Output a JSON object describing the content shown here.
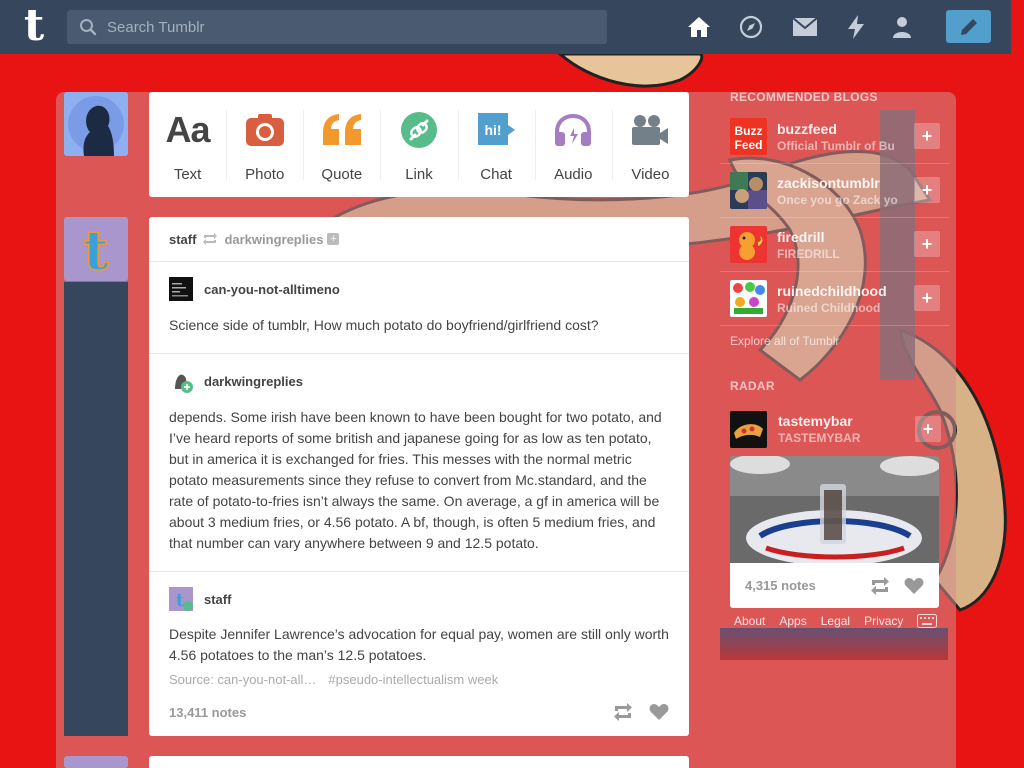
{
  "header": {
    "logo": "t",
    "search_placeholder": "Search Tumblr",
    "nav_icons": [
      "home-icon",
      "explore-icon",
      "inbox-icon",
      "activity-icon",
      "account-icon"
    ],
    "compose_icon": "pencil-icon"
  },
  "post_types": [
    {
      "label": "Text",
      "icon": "text-icon",
      "color": "#444444"
    },
    {
      "label": "Photo",
      "icon": "camera-icon",
      "color": "#d95e40"
    },
    {
      "label": "Quote",
      "icon": "quote-icon",
      "color": "#f2992e"
    },
    {
      "label": "Link",
      "icon": "link-icon",
      "color": "#56bc8a"
    },
    {
      "label": "Chat",
      "icon": "chat-icon",
      "color": "#529ecc"
    },
    {
      "label": "Audio",
      "icon": "headphones-icon",
      "color": "#a77dc2"
    },
    {
      "label": "Video",
      "icon": "video-icon",
      "color": "#748089"
    }
  ],
  "post": {
    "author": "staff",
    "reblogged_from": "darkwingreplies",
    "reblogs": [
      {
        "user": "can-you-not-alltimeno",
        "text": "Science side of tumblr, How much potato do boyfriend/girlfriend cost?"
      },
      {
        "user": "darkwingreplies",
        "text": "depends. Some irish have been known to have been bought for two potato, and I’ve heard reports of some british and japanese going for as low as ten potato, but in america it is exchanged for fries. This messes with the normal metric potato measurements since they refuse to convert from Mc.standard, and the rate of potato-to-fries isn’t always the same. On average, a gf in america will be about 3 medium fries, or 4.56 potato. A bf, though, is often 5 medium fries, and that number can vary anywhere between 9 and 12.5 potato."
      },
      {
        "user": "staff",
        "text": "Despite Jennifer Lawrence’s advocation for equal pay, women are still only worth 4.56 potatoes to the man’s 12.5 potatoes."
      }
    ],
    "source": "Source: can-you-not-all…",
    "tag": "#pseudo-intellectualism week",
    "notes": "13,411 notes"
  },
  "sidebar": {
    "recommended_title": "RECOMMENDED BLOGS",
    "blogs": [
      {
        "name": "buzzfeed",
        "subtitle": "Official Tumblr of Bu"
      },
      {
        "name": "zackisontumblr",
        "subtitle": "Once you go Zack yo"
      },
      {
        "name": "firedrill",
        "subtitle": "FIREDRILL"
      },
      {
        "name": "ruinedchildhood",
        "subtitle": "Ruined Childhood"
      }
    ],
    "buzzfeed_logo_text": [
      "Buzz",
      "Feed"
    ],
    "explore": "Explore all of Tumblr",
    "radar_title": "RADAR",
    "radar": {
      "name": "tastemybar",
      "subtitle": "TASTEMYBAR",
      "notes": "4,315 notes"
    },
    "footer_links": [
      "About",
      "Apps",
      "Legal",
      "Privacy"
    ]
  },
  "colors": {
    "header_bg": "#36465d",
    "page_bg": "#e81414",
    "accent": "#529ecc"
  }
}
